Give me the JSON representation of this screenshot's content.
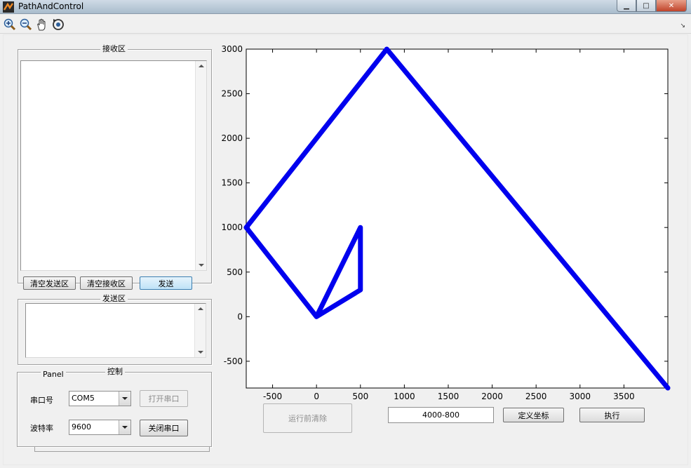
{
  "window": {
    "title": "PathAndControl",
    "minimize_glyph": "▁",
    "maximize_glyph": "□",
    "close_glyph": "✕"
  },
  "toolbar": {
    "tools": [
      "zoom-in-icon",
      "zoom-out-icon",
      "pan-hand-icon",
      "rotate-3d-icon"
    ],
    "expand_glyph": "↘"
  },
  "receive": {
    "title": "接收区",
    "text": ""
  },
  "buttons": {
    "clear_send": "清空发送区",
    "clear_receive": "清空接收区",
    "send": "发送",
    "open_port": "打开串口",
    "close_port": "关闭串口",
    "clear_before_run": "运行前清除",
    "define_coords": "定义坐标",
    "execute": "执行"
  },
  "send": {
    "title": "发送区",
    "text": ""
  },
  "control": {
    "title": "控制",
    "panel_title": "Panel",
    "port_label": "串口号",
    "port_value": "COM5",
    "baud_label": "波特率",
    "baud_value": "9600"
  },
  "coord_input": {
    "value": "4000-800"
  },
  "chart_data": {
    "type": "line",
    "title": "",
    "xlabel": "",
    "ylabel": "",
    "xlim": [
      -800,
      4000
    ],
    "ylim": [
      -800,
      3000
    ],
    "xticks": [
      -500,
      0,
      500,
      1000,
      1500,
      2000,
      2500,
      3000,
      3500
    ],
    "yticks": [
      -500,
      0,
      500,
      1000,
      1500,
      2000,
      2500,
      3000
    ],
    "grid": false,
    "series": [
      {
        "color": "#0000ee",
        "x": [
          4000,
          800,
          -800,
          0,
          500,
          500,
          0
        ],
        "y": [
          -800,
          3000,
          1000,
          0,
          300,
          1000,
          0
        ]
      }
    ]
  }
}
